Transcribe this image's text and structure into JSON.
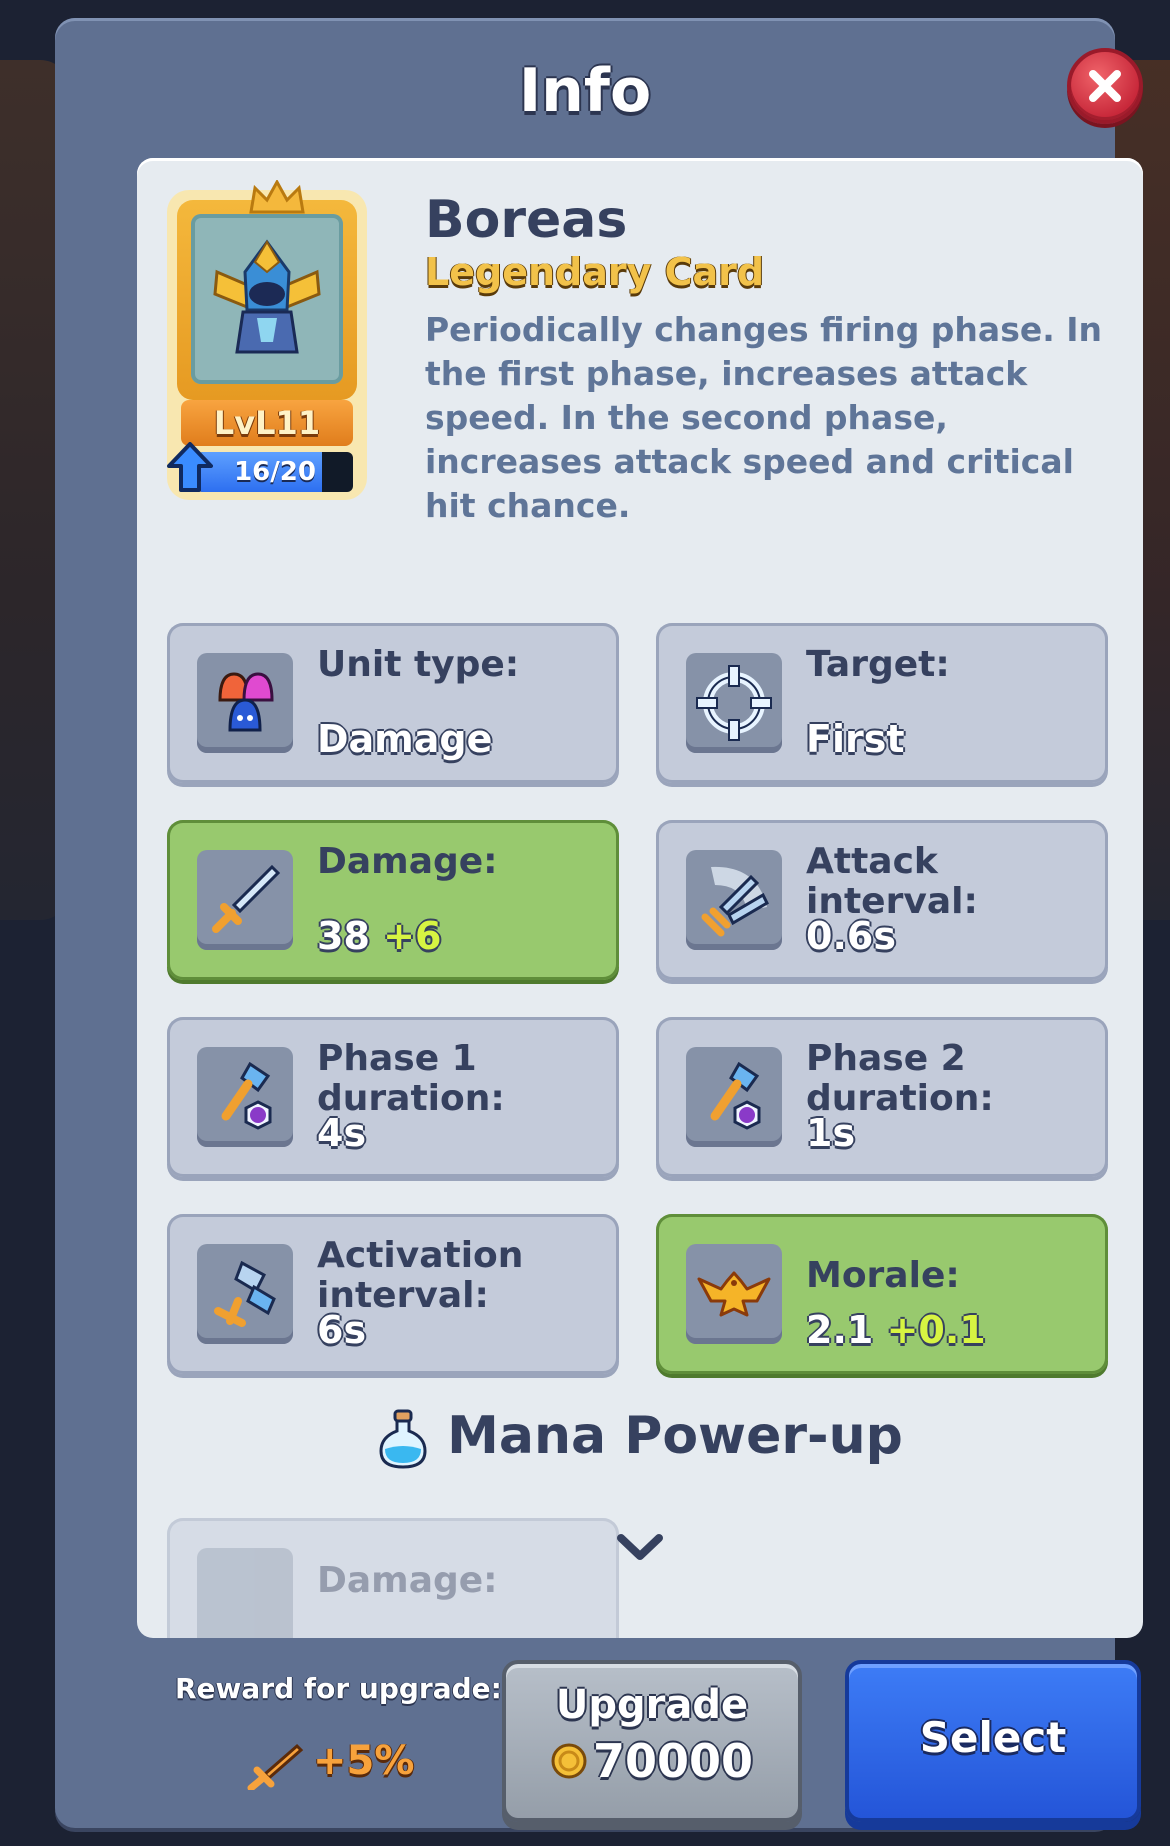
{
  "modal": {
    "title": "Info"
  },
  "card": {
    "name": "Boreas",
    "rarity": "Legendary Card",
    "level": "LvL11",
    "progress_text": "16/20",
    "progress_fraction": 0.8,
    "description": "Periodically changes firing phase. In the first phase, increases attack speed. In the second phase, increases attack speed and critical hit chance."
  },
  "stats": [
    {
      "label": "Unit type:",
      "value": "Damage",
      "bonus": "",
      "icon": "unit-type-icon"
    },
    {
      "label": "Target:",
      "value": "First",
      "bonus": "",
      "icon": "target-icon"
    },
    {
      "label": "Damage:",
      "value": "38",
      "bonus": "+6",
      "icon": "sword-icon",
      "highlight": true
    },
    {
      "label": "Attack interval:",
      "value": "0.6s",
      "bonus": "",
      "icon": "attack-interval-icon"
    },
    {
      "label": "Phase 1 duration:",
      "value": "4s",
      "bonus": "",
      "icon": "hammer-clock-icon"
    },
    {
      "label": "Phase 2 duration:",
      "value": "1s",
      "bonus": "",
      "icon": "hammer-clock-icon"
    },
    {
      "label": "Activation interval:",
      "value": "6s",
      "bonus": "",
      "icon": "activation-icon"
    },
    {
      "label": "Morale:",
      "value": "2.1",
      "bonus": "+0.1",
      "icon": "eagle-icon",
      "highlight": true
    }
  ],
  "mana": {
    "title": "Mana Power-up",
    "first_label": "Damage:"
  },
  "bottom": {
    "reward_label": "Reward for upgrade:",
    "reward_value": "+5%",
    "upgrade_label": "Upgrade",
    "upgrade_cost": "70000",
    "select_label": "Select"
  }
}
